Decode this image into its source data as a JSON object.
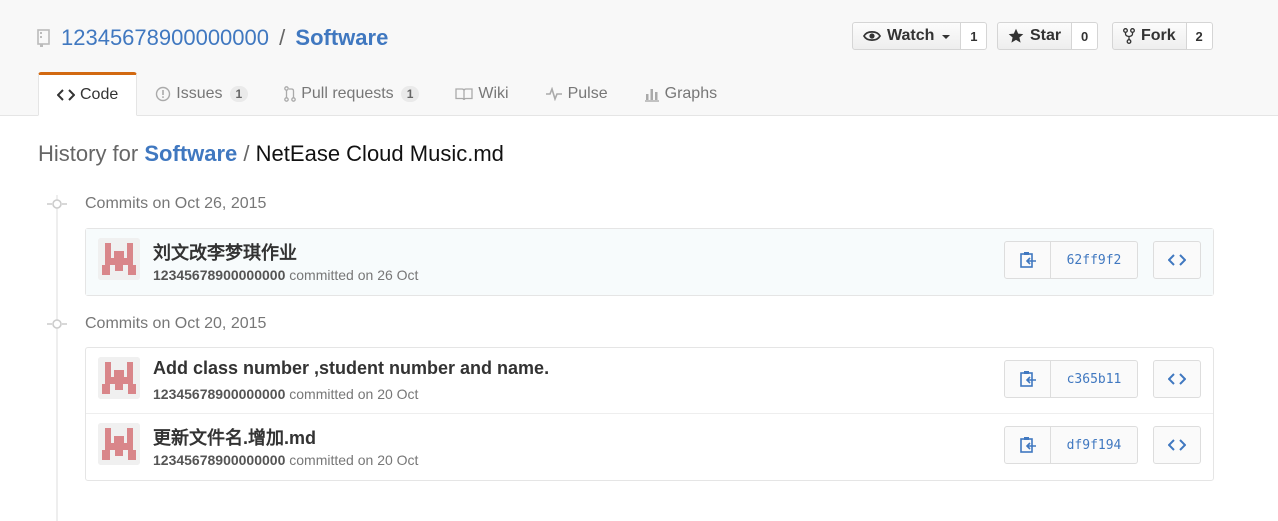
{
  "repo": {
    "owner": "12345678900000000",
    "separator": "/",
    "name": "Software"
  },
  "actions": {
    "watch": {
      "label": "Watch",
      "count": "1"
    },
    "star": {
      "label": "Star",
      "count": "0"
    },
    "fork": {
      "label": "Fork",
      "count": "2"
    }
  },
  "tabs": [
    {
      "label": "Code",
      "icon": "code-icon",
      "selected": true
    },
    {
      "label": "Issues",
      "icon": "issue-icon",
      "badge": "1"
    },
    {
      "label": "Pull requests",
      "icon": "pull-request-icon",
      "badge": "1"
    },
    {
      "label": "Wiki",
      "icon": "book-icon"
    },
    {
      "label": "Pulse",
      "icon": "pulse-icon"
    },
    {
      "label": "Graphs",
      "icon": "graph-icon"
    }
  ],
  "history": {
    "prefix": "History for",
    "repo": "Software",
    "separator": "/",
    "file": "NetEase Cloud Music.md"
  },
  "groups": [
    {
      "title": "Commits on Oct 26, 2015",
      "commits": [
        {
          "message": "刘文改李梦琪作业",
          "author": "12345678900000000",
          "meta": "committed on 26 Oct",
          "sha": "62ff9f2"
        }
      ]
    },
    {
      "title": "Commits on Oct 20, 2015",
      "commits": [
        {
          "message": "Add class number ,student number and name.",
          "author": "12345678900000000",
          "meta": "committed on 20 Oct",
          "sha": "c365b11"
        },
        {
          "message": "更新文件名.增加.md",
          "author": "12345678900000000",
          "meta": "committed on 20 Oct",
          "sha": "df9f194"
        }
      ]
    }
  ],
  "colors": {
    "link": "#4078c0",
    "selected_tab_accent": "#d26911",
    "avatar_identicon": "#d9868a"
  }
}
